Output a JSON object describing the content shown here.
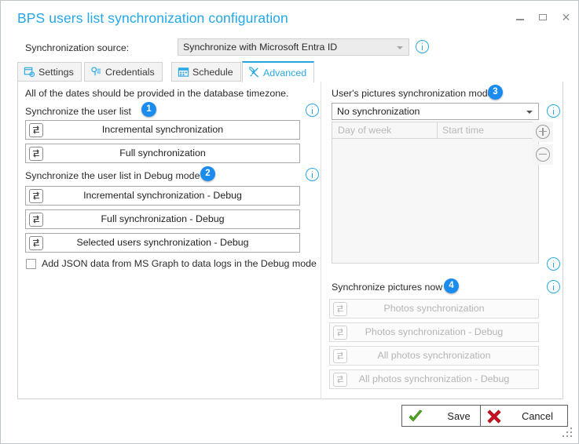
{
  "window": {
    "title": "BPS users list synchronization configuration",
    "controls": {
      "minimize": "–",
      "maximize": "□",
      "close": "×"
    }
  },
  "source": {
    "label": "Synchronization source:",
    "value": "Synchronize with Microsoft Entra ID",
    "info_tooltip": "info"
  },
  "tabs": [
    {
      "label": "Settings",
      "icon": "settings-window-icon",
      "active": false
    },
    {
      "label": "Credentials",
      "icon": "key-icon",
      "active": false
    },
    {
      "label": "Schedule",
      "icon": "calendar-icon",
      "active": false
    },
    {
      "label": "Advanced",
      "icon": "tools-icon",
      "active": true
    }
  ],
  "left_panel": {
    "note": "All of the dates should be provided in the database timezone.",
    "section1": {
      "label": "Synchronize the user list",
      "badge": "1",
      "buttons": [
        {
          "label": "Incremental synchronization",
          "icon": "sync-icon",
          "disabled": false
        },
        {
          "label": "Full synchronization",
          "icon": "sync-icon",
          "disabled": false
        }
      ]
    },
    "section2": {
      "label": "Synchronize the user list in Debug mode",
      "badge": "2",
      "buttons": [
        {
          "label": "Incremental synchronization - Debug",
          "icon": "sync-icon",
          "disabled": false
        },
        {
          "label": "Full synchronization - Debug",
          "icon": "sync-icon",
          "disabled": false
        },
        {
          "label": "Selected users synchronization - Debug",
          "icon": "sync-icon",
          "disabled": false
        }
      ]
    },
    "checkbox": {
      "label": "Add JSON data from MS Graph to data logs in the Debug mode",
      "checked": false
    }
  },
  "right_panel": {
    "section3": {
      "label": "User's pictures synchronization mode:",
      "badge": "3",
      "combo_value": "No synchronization"
    },
    "grid": {
      "columns": [
        "Day of week",
        "Start time"
      ],
      "rows": [],
      "add_button": "add-row-button",
      "remove_button": "remove-row-button"
    },
    "section4": {
      "label": "Synchronize pictures now",
      "badge": "4",
      "buttons": [
        {
          "label": "Photos synchronization",
          "icon": "sync-icon",
          "disabled": true
        },
        {
          "label": "Photos synchronization - Debug",
          "icon": "sync-icon",
          "disabled": true
        },
        {
          "label": "All photos synchronization",
          "icon": "sync-icon",
          "disabled": true
        },
        {
          "label": "All photos synchronization - Debug",
          "icon": "sync-icon",
          "disabled": true
        }
      ]
    }
  },
  "footer": {
    "save_label": "Save",
    "cancel_label": "Cancel"
  },
  "colors": {
    "accent": "#29a8e8",
    "badge": "#1a8cf0",
    "title": "#23a7e8",
    "save_check": "#4ca521",
    "cancel_x": "#cc1122"
  }
}
